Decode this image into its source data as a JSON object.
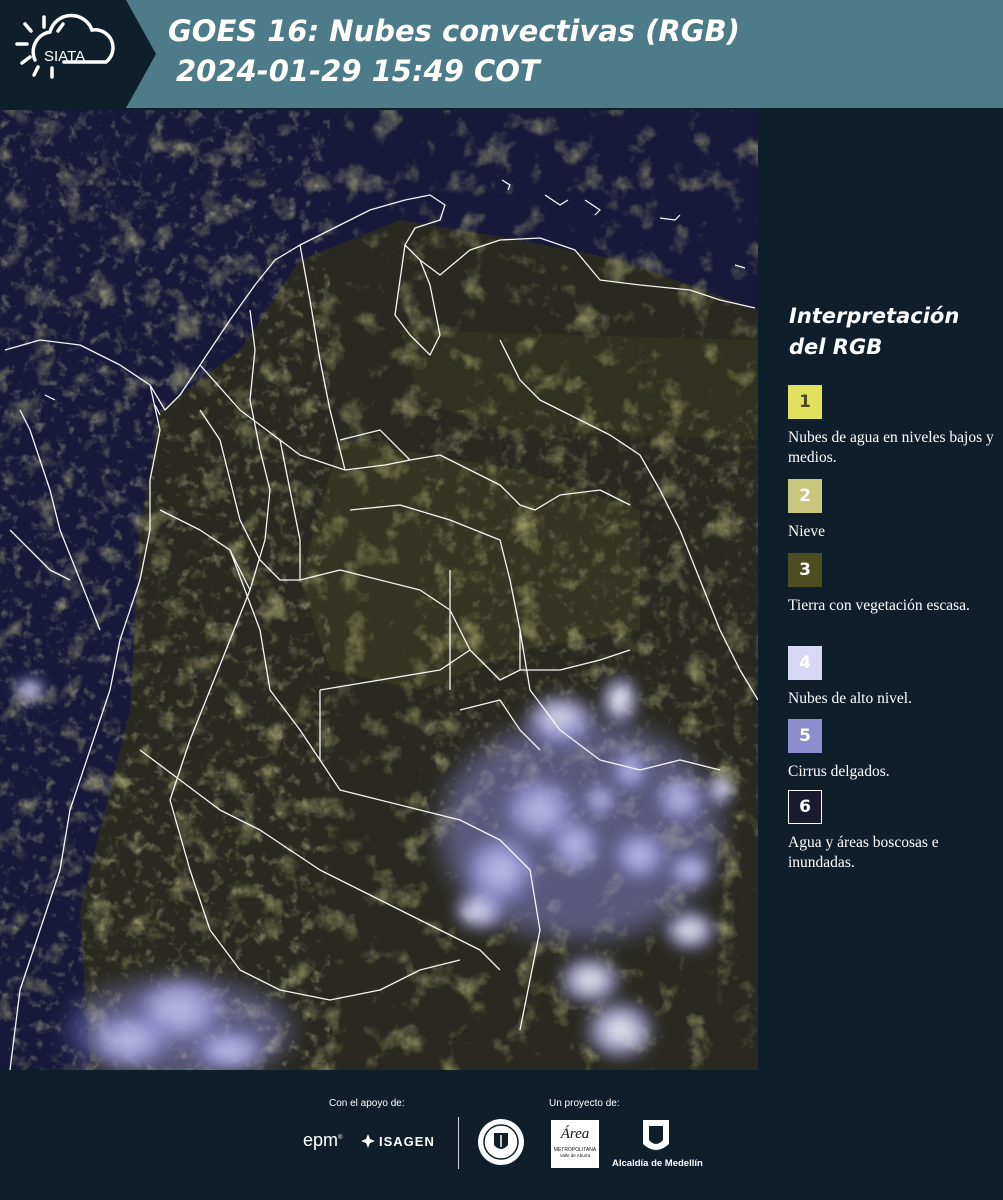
{
  "header": {
    "logo_text": "SIATA",
    "title_line1": "GOES 16: Nubes convectivas (RGB)",
    "title_line2": "2024-01-29 15:49 COT",
    "background_color": "#4e7b8a",
    "logo_tab_color": "#0e1f2b"
  },
  "legend": {
    "title_line1": "Interpretación",
    "title_line2": "del RGB",
    "items": [
      {
        "number": "1",
        "text": "Nubes de agua en niveles bajos y medios.",
        "color": "#e2e05f"
      },
      {
        "number": "2",
        "text": "Nieve",
        "color": "#c9c67e"
      },
      {
        "number": "3",
        "text": "Tierra con vegetación escasa.",
        "color": "#4e4d22"
      },
      {
        "number": "4",
        "text": "Nubes de alto nivel.",
        "color": "#d8d8f6"
      },
      {
        "number": "5",
        "text": "Cirrus delgados.",
        "color": "#8d8ccc"
      },
      {
        "number": "6",
        "text": "Agua y áreas boscosas e inundadas.",
        "color": "#191a2f"
      }
    ]
  },
  "footer": {
    "support_label": "Con el apoyo de:",
    "project_label": "Un proyecto de:",
    "epm_logo_text": "epm",
    "isagen_logo_text": "ISAGEN",
    "area_logo_text": "Área",
    "area_logo_subtext": "METROPOLITANA",
    "area_logo_subtext2": "Valle de Aburrá",
    "alcaldia_label": "Alcaldía de Medellín"
  },
  "map": {
    "description_icon": "satellite-rgb-image",
    "background_color": "#17183a",
    "border_color": "#ffffff"
  }
}
